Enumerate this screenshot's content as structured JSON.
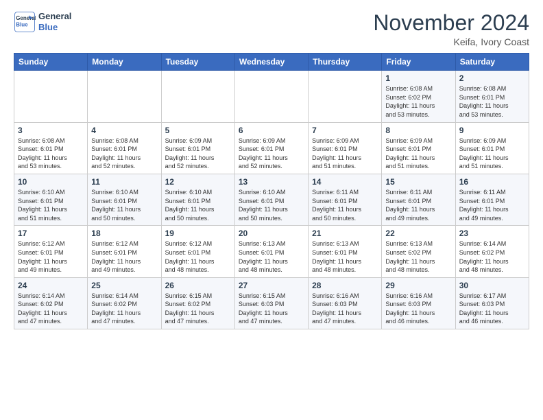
{
  "logo": {
    "line1": "General",
    "line2": "Blue"
  },
  "title": "November 2024",
  "location": "Keifa, Ivory Coast",
  "weekdays": [
    "Sunday",
    "Monday",
    "Tuesday",
    "Wednesday",
    "Thursday",
    "Friday",
    "Saturday"
  ],
  "weeks": [
    [
      {
        "day": "",
        "info": ""
      },
      {
        "day": "",
        "info": ""
      },
      {
        "day": "",
        "info": ""
      },
      {
        "day": "",
        "info": ""
      },
      {
        "day": "",
        "info": ""
      },
      {
        "day": "1",
        "info": "Sunrise: 6:08 AM\nSunset: 6:02 PM\nDaylight: 11 hours\nand 53 minutes."
      },
      {
        "day": "2",
        "info": "Sunrise: 6:08 AM\nSunset: 6:01 PM\nDaylight: 11 hours\nand 53 minutes."
      }
    ],
    [
      {
        "day": "3",
        "info": "Sunrise: 6:08 AM\nSunset: 6:01 PM\nDaylight: 11 hours\nand 53 minutes."
      },
      {
        "day": "4",
        "info": "Sunrise: 6:08 AM\nSunset: 6:01 PM\nDaylight: 11 hours\nand 52 minutes."
      },
      {
        "day": "5",
        "info": "Sunrise: 6:09 AM\nSunset: 6:01 PM\nDaylight: 11 hours\nand 52 minutes."
      },
      {
        "day": "6",
        "info": "Sunrise: 6:09 AM\nSunset: 6:01 PM\nDaylight: 11 hours\nand 52 minutes."
      },
      {
        "day": "7",
        "info": "Sunrise: 6:09 AM\nSunset: 6:01 PM\nDaylight: 11 hours\nand 51 minutes."
      },
      {
        "day": "8",
        "info": "Sunrise: 6:09 AM\nSunset: 6:01 PM\nDaylight: 11 hours\nand 51 minutes."
      },
      {
        "day": "9",
        "info": "Sunrise: 6:09 AM\nSunset: 6:01 PM\nDaylight: 11 hours\nand 51 minutes."
      }
    ],
    [
      {
        "day": "10",
        "info": "Sunrise: 6:10 AM\nSunset: 6:01 PM\nDaylight: 11 hours\nand 51 minutes."
      },
      {
        "day": "11",
        "info": "Sunrise: 6:10 AM\nSunset: 6:01 PM\nDaylight: 11 hours\nand 50 minutes."
      },
      {
        "day": "12",
        "info": "Sunrise: 6:10 AM\nSunset: 6:01 PM\nDaylight: 11 hours\nand 50 minutes."
      },
      {
        "day": "13",
        "info": "Sunrise: 6:10 AM\nSunset: 6:01 PM\nDaylight: 11 hours\nand 50 minutes."
      },
      {
        "day": "14",
        "info": "Sunrise: 6:11 AM\nSunset: 6:01 PM\nDaylight: 11 hours\nand 50 minutes."
      },
      {
        "day": "15",
        "info": "Sunrise: 6:11 AM\nSunset: 6:01 PM\nDaylight: 11 hours\nand 49 minutes."
      },
      {
        "day": "16",
        "info": "Sunrise: 6:11 AM\nSunset: 6:01 PM\nDaylight: 11 hours\nand 49 minutes."
      }
    ],
    [
      {
        "day": "17",
        "info": "Sunrise: 6:12 AM\nSunset: 6:01 PM\nDaylight: 11 hours\nand 49 minutes."
      },
      {
        "day": "18",
        "info": "Sunrise: 6:12 AM\nSunset: 6:01 PM\nDaylight: 11 hours\nand 49 minutes."
      },
      {
        "day": "19",
        "info": "Sunrise: 6:12 AM\nSunset: 6:01 PM\nDaylight: 11 hours\nand 48 minutes."
      },
      {
        "day": "20",
        "info": "Sunrise: 6:13 AM\nSunset: 6:01 PM\nDaylight: 11 hours\nand 48 minutes."
      },
      {
        "day": "21",
        "info": "Sunrise: 6:13 AM\nSunset: 6:01 PM\nDaylight: 11 hours\nand 48 minutes."
      },
      {
        "day": "22",
        "info": "Sunrise: 6:13 AM\nSunset: 6:02 PM\nDaylight: 11 hours\nand 48 minutes."
      },
      {
        "day": "23",
        "info": "Sunrise: 6:14 AM\nSunset: 6:02 PM\nDaylight: 11 hours\nand 48 minutes."
      }
    ],
    [
      {
        "day": "24",
        "info": "Sunrise: 6:14 AM\nSunset: 6:02 PM\nDaylight: 11 hours\nand 47 minutes."
      },
      {
        "day": "25",
        "info": "Sunrise: 6:14 AM\nSunset: 6:02 PM\nDaylight: 11 hours\nand 47 minutes."
      },
      {
        "day": "26",
        "info": "Sunrise: 6:15 AM\nSunset: 6:02 PM\nDaylight: 11 hours\nand 47 minutes."
      },
      {
        "day": "27",
        "info": "Sunrise: 6:15 AM\nSunset: 6:03 PM\nDaylight: 11 hours\nand 47 minutes."
      },
      {
        "day": "28",
        "info": "Sunrise: 6:16 AM\nSunset: 6:03 PM\nDaylight: 11 hours\nand 47 minutes."
      },
      {
        "day": "29",
        "info": "Sunrise: 6:16 AM\nSunset: 6:03 PM\nDaylight: 11 hours\nand 46 minutes."
      },
      {
        "day": "30",
        "info": "Sunrise: 6:17 AM\nSunset: 6:03 PM\nDaylight: 11 hours\nand 46 minutes."
      }
    ]
  ]
}
